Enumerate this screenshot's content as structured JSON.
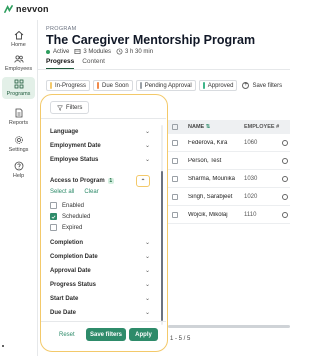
{
  "app": {
    "brand": "nevvon"
  },
  "sidebar": {
    "items": [
      {
        "label": "Home",
        "icon": "home-icon"
      },
      {
        "label": "Employees",
        "icon": "users-icon"
      },
      {
        "label": "Programs",
        "icon": "grid-icon",
        "active": true
      },
      {
        "label": "Reports",
        "icon": "report-icon"
      },
      {
        "label": "Settings",
        "icon": "gear-icon"
      },
      {
        "label": "Help",
        "icon": "help-icon"
      }
    ]
  },
  "header": {
    "section_label": "PROGRAM",
    "title": "The Caregiver Mentorship Program",
    "status": "Active",
    "modules": "3 Modules",
    "duration": "3 h 30 min",
    "status_color": "#2e9e5e"
  },
  "tabs": [
    {
      "label": "Progress",
      "active": true
    },
    {
      "label": "Content"
    }
  ],
  "status_chips": [
    {
      "label": "In-Progress",
      "color": "#f3c96a"
    },
    {
      "label": "Due Soon",
      "color": "#f08a4b"
    },
    {
      "label": "Pending Approval",
      "color": "#9aa0a6"
    },
    {
      "label": "Approved",
      "color": "#3fb58a"
    }
  ],
  "save_filters_link": "Save filters",
  "filter_panel": {
    "filters_button": "Filters",
    "rows_top": [
      "Language",
      "Employment Date",
      "Employee Status"
    ],
    "access_to_program": {
      "label": "Access to Program",
      "count": "1"
    },
    "select_all": "Select all",
    "clear": "Clear",
    "options": [
      {
        "label": "Enabled",
        "checked": false
      },
      {
        "label": "Scheduled",
        "checked": true
      },
      {
        "label": "Expired",
        "checked": false
      }
    ],
    "rows_bottom": [
      "Completion",
      "Completion Date",
      "Approval Date",
      "Progress Status",
      "Start Date",
      "Due Date"
    ],
    "reset": "Reset",
    "save_filters": "Save filters",
    "apply": "Apply",
    "accent": "#2e8b6a",
    "highlight": "#f3c96a"
  },
  "table": {
    "columns": {
      "name": "NAME",
      "employee": "EMPLOYEE #"
    },
    "rows": [
      {
        "name": "Federova, Kira",
        "employee": "1060"
      },
      {
        "name": "Person, Test",
        "employee": ""
      },
      {
        "name": "Sharma, Mounika",
        "employee": "1030"
      },
      {
        "name": "Singh, Sarabjeet",
        "employee": "1020"
      },
      {
        "name": "Wojcik, Mikolaj",
        "employee": "1110"
      }
    ]
  },
  "pager": "1 - 5 / 5"
}
